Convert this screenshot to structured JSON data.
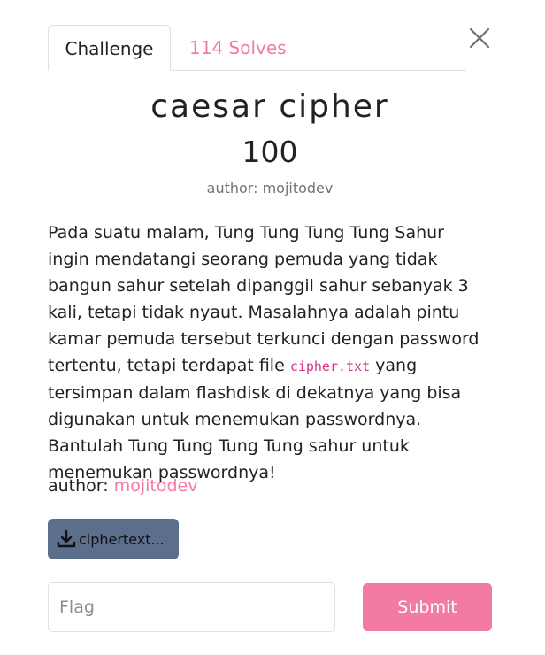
{
  "tabs": {
    "challenge_label": "Challenge",
    "solves_label": "114 Solves"
  },
  "challenge": {
    "name": "caesar cipher",
    "value": "100",
    "author_line": "author: mojitodev",
    "description_part1": "Pada suatu malam, Tung Tung Tung Tung Sahur ingin mendatangi seorang pemuda yang tidak bangun sahur setelah dipanggil sahur sebanyak 3 kali, tetapi tidak nyaut. Masalahnya adalah pintu kamar pemuda tersebut terkunci dengan password tertentu, tetapi terdapat file ",
    "description_code": "cipher.txt",
    "description_part2": " yang tersimpan dalam flashdisk di dekatnya yang bisa digunakan untuk menemukan passwordnya. Bantulah Tung Tung Tung Tung sahur untuk menemukan passwordnya!",
    "author_prefix": "author: ",
    "author_name": "mojitodev"
  },
  "files": {
    "download_label": "ciphertext..."
  },
  "form": {
    "flag_placeholder": "Flag",
    "flag_value": "",
    "submit_label": "Submit"
  },
  "icons": {
    "close": "close-icon",
    "download": "download-icon"
  },
  "colors": {
    "accent_pink": "#f27aa5",
    "file_button": "#5b6e8b",
    "muted_text": "#6c757d",
    "code_text": "#d63384"
  }
}
